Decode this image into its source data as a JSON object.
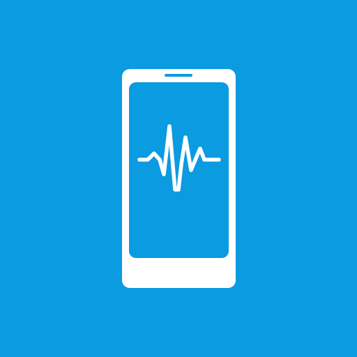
{
  "app_icon": {
    "icon": "phone-waveform-icon",
    "colors": {
      "background": "#0a9be0",
      "foreground": "#ffffff"
    }
  }
}
